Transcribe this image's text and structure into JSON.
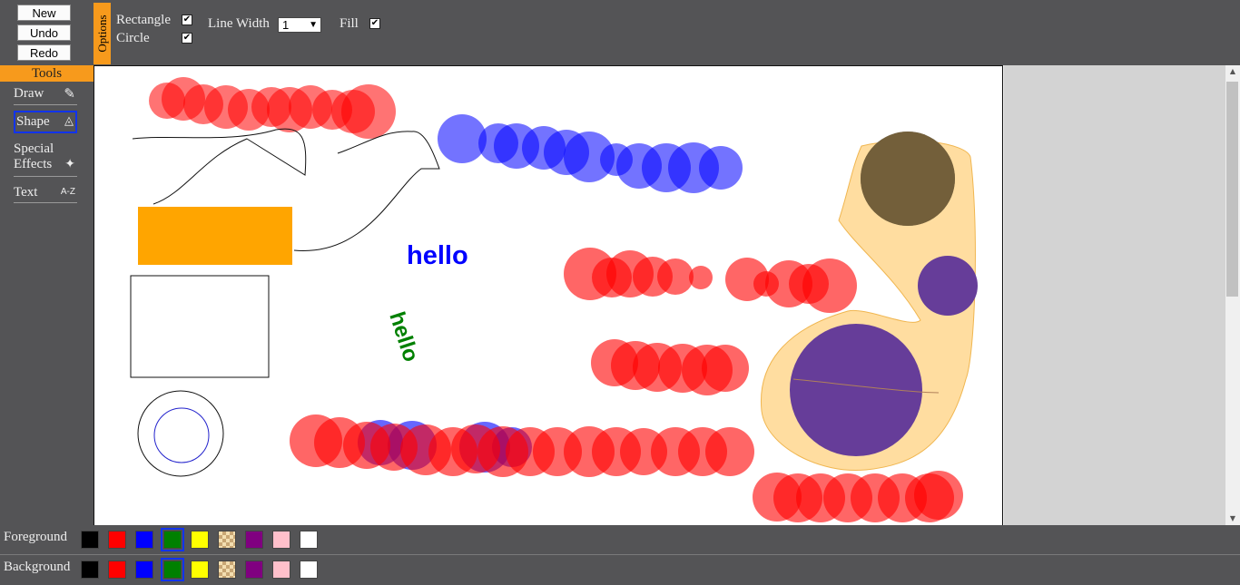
{
  "buttons": {
    "new": "New",
    "undo": "Undo",
    "redo": "Redo"
  },
  "options": {
    "tab_label": "Options",
    "rectangle_label": "Rectangle",
    "rectangle_checked": true,
    "circle_label": "Circle",
    "circle_checked": true,
    "line_width_label": "Line Width",
    "line_width_value": "1",
    "fill_label": "Fill",
    "fill_checked": true
  },
  "tools": {
    "header": "Tools",
    "draw": "Draw",
    "shape": "Shape",
    "special1": "Special",
    "special2": "Effects",
    "text": "Text",
    "text_icon": "A-Z",
    "icons": [
      "pencil-icon",
      "shapes-icon",
      "sparkle-icon",
      "text-az-icon"
    ],
    "active": "Shape"
  },
  "canvas": {
    "text_blue": "hello",
    "text_green": "hello"
  },
  "palette": {
    "foreground_label": "Foreground",
    "background_label": "Background",
    "colors": [
      "#000000",
      "#ff0000",
      "#0000ff",
      "#008000",
      "#ffff00",
      "checker",
      "#800080",
      "#ffc0cb",
      "#ffffff"
    ],
    "foreground_selected": "#008000",
    "background_selected": "#008000"
  }
}
